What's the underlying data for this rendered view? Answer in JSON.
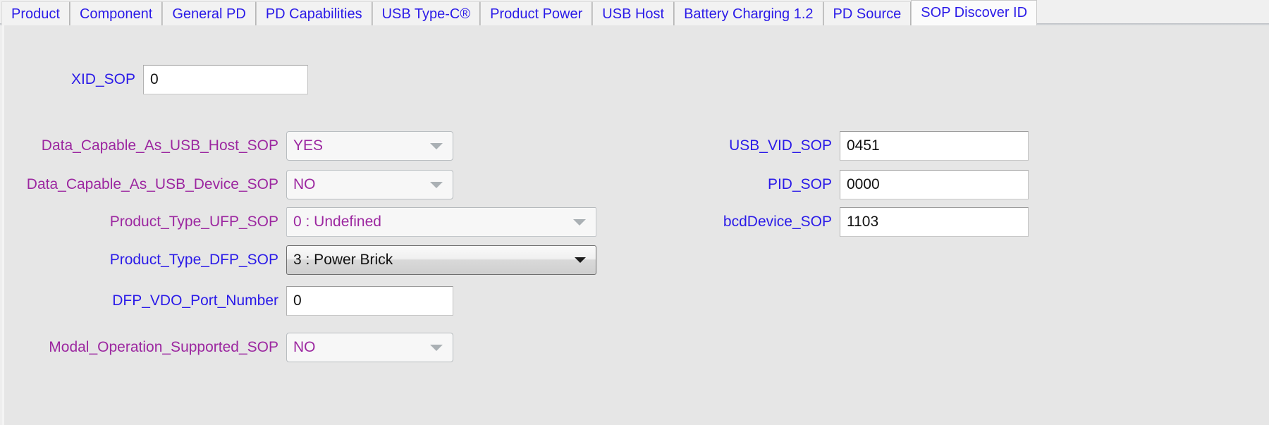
{
  "tabs": [
    {
      "label": "Product",
      "active": false
    },
    {
      "label": "Component",
      "active": false
    },
    {
      "label": "General PD",
      "active": false
    },
    {
      "label": "PD Capabilities",
      "active": false
    },
    {
      "label": "USB Type-C®",
      "active": false
    },
    {
      "label": "Product Power",
      "active": false
    },
    {
      "label": "USB Host",
      "active": false
    },
    {
      "label": "Battery Charging 1.2",
      "active": false
    },
    {
      "label": "PD Source",
      "active": false
    },
    {
      "label": "SOP Discover ID",
      "active": true
    }
  ],
  "colors": {
    "label_purple": "#9c27a0",
    "label_blue": "#2a1ae8",
    "page_background": "#e6e6e6",
    "tab_background": "#f2f2f2",
    "active_tab_background": "#fbfbfb"
  },
  "form": {
    "left": {
      "xid_sop": {
        "label": "XID_SOP",
        "value": "0",
        "type": "textbox",
        "label_color": "blue"
      },
      "data_capable_as_usb_host_sop": {
        "label": "Data_Capable_As_USB_Host_SOP",
        "value": "YES",
        "type": "combobox",
        "label_color": "purple"
      },
      "data_capable_as_usb_device_sop": {
        "label": "Data_Capable_As_USB_Device_SOP",
        "value": "NO",
        "type": "combobox",
        "label_color": "purple"
      },
      "product_type_ufp_sop": {
        "label": "Product_Type_UFP_SOP",
        "value": "0 : Undefined",
        "type": "combobox",
        "label_color": "purple"
      },
      "product_type_dfp_sop": {
        "label": "Product_Type_DFP_SOP",
        "value": "3 : Power Brick",
        "type": "combobox",
        "label_color": "blue"
      },
      "dfp_vdo_port_number": {
        "label": "DFP_VDO_Port_Number",
        "value": "0",
        "type": "textbox",
        "label_color": "blue"
      },
      "modal_operation_supported_sop": {
        "label": "Modal_Operation_Supported_SOP",
        "value": "NO",
        "type": "combobox",
        "label_color": "purple"
      }
    },
    "right": {
      "usb_vid_sop": {
        "label": "USB_VID_SOP",
        "value": "0451",
        "type": "textbox",
        "label_color": "blue"
      },
      "pid_sop": {
        "label": "PID_SOP",
        "value": "0000",
        "type": "textbox",
        "label_color": "blue"
      },
      "bcddevice_sop": {
        "label": "bcdDevice_SOP",
        "value": "1103",
        "type": "textbox",
        "label_color": "blue"
      }
    }
  }
}
